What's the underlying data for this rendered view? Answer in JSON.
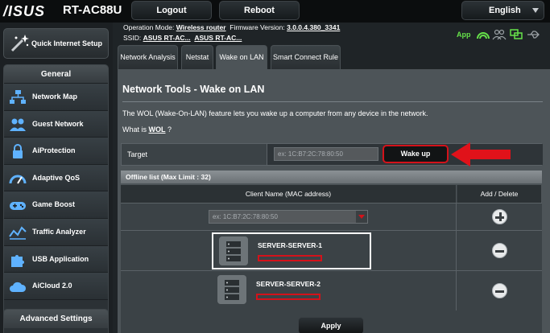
{
  "header": {
    "brand": "/ISUS",
    "model": "RT-AC88U",
    "logout_label": "Logout",
    "reboot_label": "Reboot",
    "language": "English"
  },
  "info": {
    "op_mode_label": "Operation Mode:",
    "op_mode_value": "Wireless router",
    "fw_label": "Firmware Version:",
    "fw_value": "3.0.0.4.380_3341",
    "ssid_label": "SSID:",
    "ssid_1": "ASUS RT-AC...",
    "ssid_2": "ASUS RT-AC...",
    "app_label": "App"
  },
  "sidebar": {
    "quick_setup_label": "Quick Internet Setup",
    "general_header": "General",
    "items": [
      {
        "label": "Network Map",
        "icon": "network-map-icon"
      },
      {
        "label": "Guest Network",
        "icon": "guest-network-icon"
      },
      {
        "label": "AiProtection",
        "icon": "lock-icon"
      },
      {
        "label": "Adaptive QoS",
        "icon": "qos-gauge-icon"
      },
      {
        "label": "Game Boost",
        "icon": "gamepad-icon"
      },
      {
        "label": "Traffic Analyzer",
        "icon": "traffic-chart-icon"
      },
      {
        "label": "USB Application",
        "icon": "puzzle-icon"
      },
      {
        "label": "AiCloud 2.0",
        "icon": "cloud-icon"
      }
    ],
    "advanced_header": "Advanced Settings"
  },
  "tabs": [
    {
      "label": "Network Analysis",
      "active": false
    },
    {
      "label": "Netstat",
      "active": false
    },
    {
      "label": "Wake on LAN",
      "active": true
    },
    {
      "label": "Smart Connect Rule",
      "active": false
    }
  ],
  "main": {
    "title": "Network Tools - Wake on LAN",
    "description": "The WOL (Wake-On-LAN) feature lets you wake up a computer from any device in the network.",
    "what_is_prefix": "What is ",
    "what_is_link": "WOL",
    "what_is_suffix": " ?",
    "target_label": "Target",
    "target_placeholder": "ex: 1C:B7:2C:78:80:50",
    "wake_label": "Wake up",
    "offline_header": "Offline list (Max Limit : 32)",
    "col_client": "Client Name (MAC address)",
    "col_action": "Add / Delete",
    "client_placeholder": "ex: 1C:B7:2C:78:80:50",
    "clients": [
      {
        "name": "SERVER-SERVER-1"
      },
      {
        "name": "SERVER-SERVER-2"
      }
    ],
    "apply_label": "Apply"
  },
  "colors": {
    "accent_red": "#d4121a",
    "app_green": "#66e24a",
    "panel_bg": "#4d5458"
  }
}
